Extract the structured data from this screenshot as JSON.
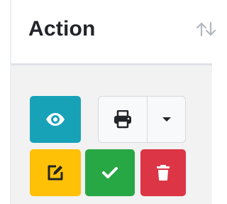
{
  "column": {
    "title": "Action",
    "sort_icon": "sort-arrows-icon"
  },
  "actions": {
    "view": {
      "icon": "eye-icon",
      "color": "#17a2b8"
    },
    "print": {
      "icon": "printer-icon",
      "color": "#f8f9fa"
    },
    "print_menu": {
      "icon": "caret-down-icon"
    },
    "edit": {
      "icon": "edit-icon",
      "color": "#ffc107"
    },
    "approve": {
      "icon": "check-icon",
      "color": "#28a745"
    },
    "delete": {
      "icon": "trash-icon",
      "color": "#dc3545"
    }
  }
}
